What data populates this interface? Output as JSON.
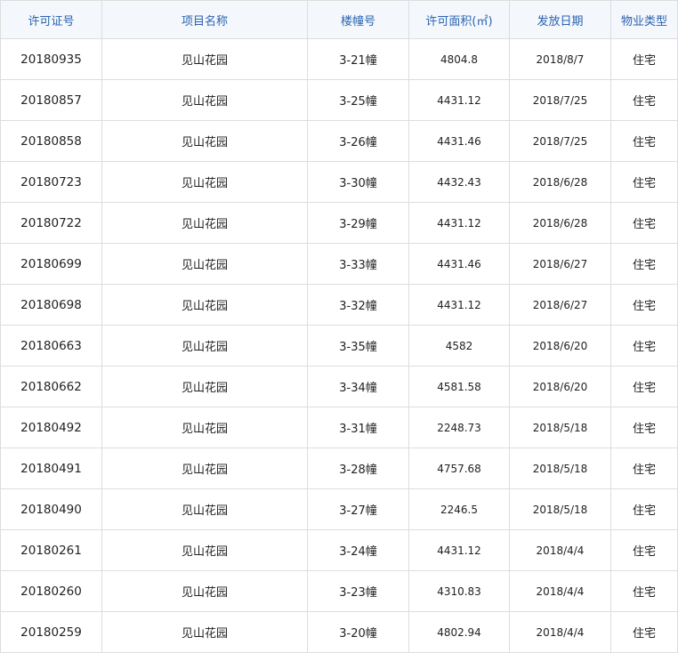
{
  "table": {
    "headers": [
      "许可证号",
      "项目名称",
      "楼幢号",
      "许可面积(㎡)",
      "发放日期",
      "物业类型"
    ],
    "rows": [
      {
        "permit_no": "20180935",
        "project": "见山花园",
        "building": "3-21幢",
        "area": "4804.8",
        "date": "2018/8/7",
        "type": "住宅"
      },
      {
        "permit_no": "20180857",
        "project": "见山花园",
        "building": "3-25幢",
        "area": "4431.12",
        "date": "2018/7/25",
        "type": "住宅"
      },
      {
        "permit_no": "20180858",
        "project": "见山花园",
        "building": "3-26幢",
        "area": "4431.46",
        "date": "2018/7/25",
        "type": "住宅"
      },
      {
        "permit_no": "20180723",
        "project": "见山花园",
        "building": "3-30幢",
        "area": "4432.43",
        "date": "2018/6/28",
        "type": "住宅"
      },
      {
        "permit_no": "20180722",
        "project": "见山花园",
        "building": "3-29幢",
        "area": "4431.12",
        "date": "2018/6/28",
        "type": "住宅"
      },
      {
        "permit_no": "20180699",
        "project": "见山花园",
        "building": "3-33幢",
        "area": "4431.46",
        "date": "2018/6/27",
        "type": "住宅"
      },
      {
        "permit_no": "20180698",
        "project": "见山花园",
        "building": "3-32幢",
        "area": "4431.12",
        "date": "2018/6/27",
        "type": "住宅"
      },
      {
        "permit_no": "20180663",
        "project": "见山花园",
        "building": "3-35幢",
        "area": "4582",
        "date": "2018/6/20",
        "type": "住宅"
      },
      {
        "permit_no": "20180662",
        "project": "见山花园",
        "building": "3-34幢",
        "area": "4581.58",
        "date": "2018/6/20",
        "type": "住宅"
      },
      {
        "permit_no": "20180492",
        "project": "见山花园",
        "building": "3-31幢",
        "area": "2248.73",
        "date": "2018/5/18",
        "type": "住宅"
      },
      {
        "permit_no": "20180491",
        "project": "见山花园",
        "building": "3-28幢",
        "area": "4757.68",
        "date": "2018/5/18",
        "type": "住宅"
      },
      {
        "permit_no": "20180490",
        "project": "见山花园",
        "building": "3-27幢",
        "area": "2246.5",
        "date": "2018/5/18",
        "type": "住宅"
      },
      {
        "permit_no": "20180261",
        "project": "见山花园",
        "building": "3-24幢",
        "area": "4431.12",
        "date": "2018/4/4",
        "type": "住宅"
      },
      {
        "permit_no": "20180260",
        "project": "见山花园",
        "building": "3-23幢",
        "area": "4310.83",
        "date": "2018/4/4",
        "type": "住宅"
      },
      {
        "permit_no": "20180259",
        "project": "见山花园",
        "building": "3-20幢",
        "area": "4802.94",
        "date": "2018/4/4",
        "type": "住宅"
      }
    ]
  },
  "colors": {
    "header_text": "#2a63b0",
    "header_bg": "#f4f7fb",
    "border": "#dddddd"
  }
}
